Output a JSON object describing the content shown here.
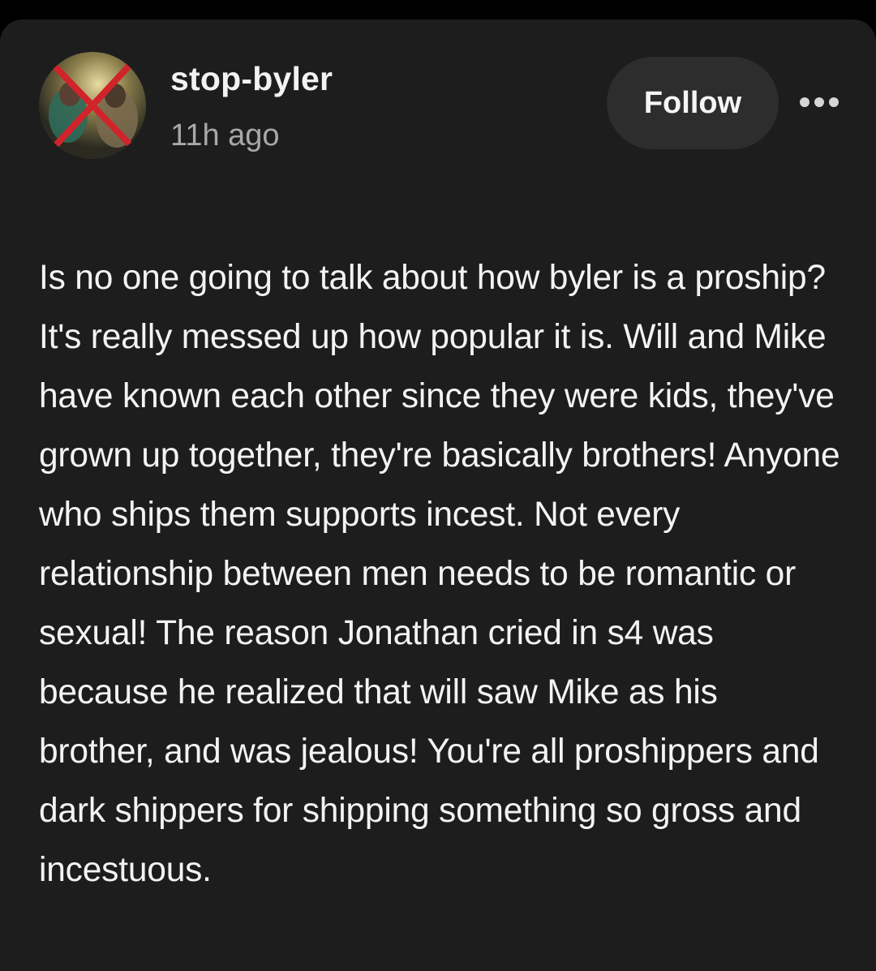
{
  "post": {
    "author": {
      "username": "stop-byler",
      "avatar_icon": "avatar-crossed-out-photo-icon"
    },
    "time_ago": "11h ago",
    "follow_label": "Follow",
    "more_icon": "more-options-icon",
    "text": "Is no one going to talk about how byler is a proship? It's really messed up how popular it is. Will and Mike have known each other since they were kids, they've grown up together, they're basically brothers! Anyone who ships them supports incest. Not every relationship between men needs to be romantic or sexual! The reason Jonathan cried in s4 was because he realized that will saw Mike as his brother, and was jealous! You're all proshippers and dark shippers for shipping something so gross and incestuous."
  },
  "colors": {
    "background": "#000000",
    "card": "#1d1d1d",
    "button": "#2d2d2d",
    "text_primary": "#f3f3f3",
    "text_secondary": "#a8a8a8",
    "avatar_cross": "#d1232a"
  }
}
